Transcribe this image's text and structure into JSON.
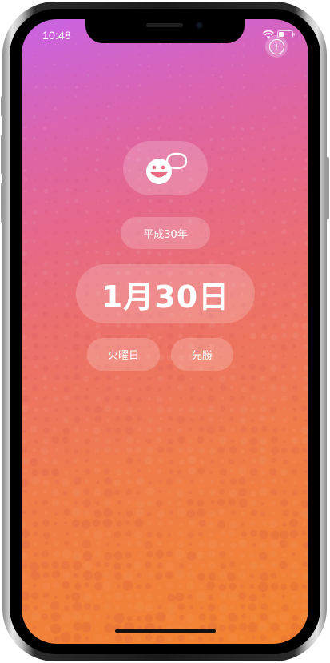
{
  "status_bar": {
    "time": "10:48",
    "icons": [
      "wifi-icon",
      "battery-icon"
    ]
  },
  "toolbar": {
    "info_icon": "info-icon",
    "info_glyph": "i"
  },
  "main": {
    "mascot_icon": "smiley-speech-bubble-icon",
    "era_year": "平成30年",
    "date": "1月30日",
    "weekday": "火曜日",
    "rokuyo": "先勝"
  },
  "colors": {
    "gradient_top": "#c863e4",
    "gradient_mid": "#ec6f6e",
    "gradient_bottom": "#f2832e",
    "pill_background": "rgba(255,255,255,0.2)",
    "text": "#ffffff"
  }
}
